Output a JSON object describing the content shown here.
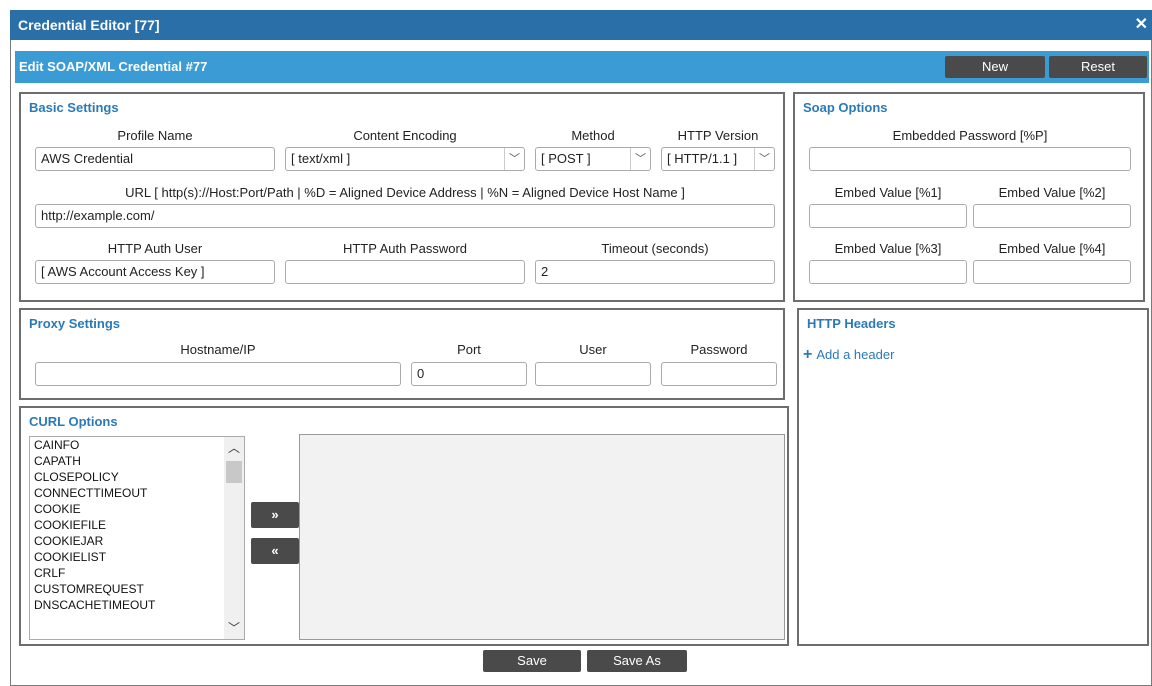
{
  "window": {
    "title": "Credential Editor [77]"
  },
  "header": {
    "title": "Edit SOAP/XML Credential #77",
    "new_label": "New",
    "reset_label": "Reset"
  },
  "basic": {
    "title": "Basic Settings",
    "profile_name_label": "Profile Name",
    "profile_name_value": "AWS Credential",
    "content_encoding_label": "Content Encoding",
    "content_encoding_value": "[ text/xml ]",
    "method_label": "Method",
    "method_value": "[ POST ]",
    "http_version_label": "HTTP Version",
    "http_version_value": "[ HTTP/1.1 ]",
    "url_label": "URL [ http(s)://Host:Port/Path | %D = Aligned Device Address | %N = Aligned Device Host Name ]",
    "url_value": "http://example.com/",
    "auth_user_label": "HTTP Auth User",
    "auth_user_value": "[ AWS Account Access Key ]",
    "auth_password_label": "HTTP Auth Password",
    "auth_password_value": "",
    "timeout_label": "Timeout (seconds)",
    "timeout_value": "2"
  },
  "soap": {
    "title": "Soap Options",
    "embedded_password_label": "Embedded Password [%P]",
    "embed1_label": "Embed Value [%1]",
    "embed2_label": "Embed Value [%2]",
    "embed3_label": "Embed Value [%3]",
    "embed4_label": "Embed Value [%4]"
  },
  "proxy": {
    "title": "Proxy Settings",
    "hostname_label": "Hostname/IP",
    "hostname_value": "",
    "port_label": "Port",
    "port_value": "0",
    "user_label": "User",
    "user_value": "",
    "password_label": "Password",
    "password_value": ""
  },
  "headers": {
    "title": "HTTP Headers",
    "add_label": "Add a header"
  },
  "curl": {
    "title": "CURL Options",
    "options": [
      "CAINFO",
      "CAPATH",
      "CLOSEPOLICY",
      "CONNECTTIMEOUT",
      "COOKIE",
      "COOKIEFILE",
      "COOKIEJAR",
      "COOKIELIST",
      "CRLF",
      "CUSTOMREQUEST",
      "DNSCACHETIMEOUT"
    ],
    "add_glyph": "»",
    "remove_glyph": "«"
  },
  "footer": {
    "save_label": "Save",
    "save_as_label": "Save As"
  }
}
